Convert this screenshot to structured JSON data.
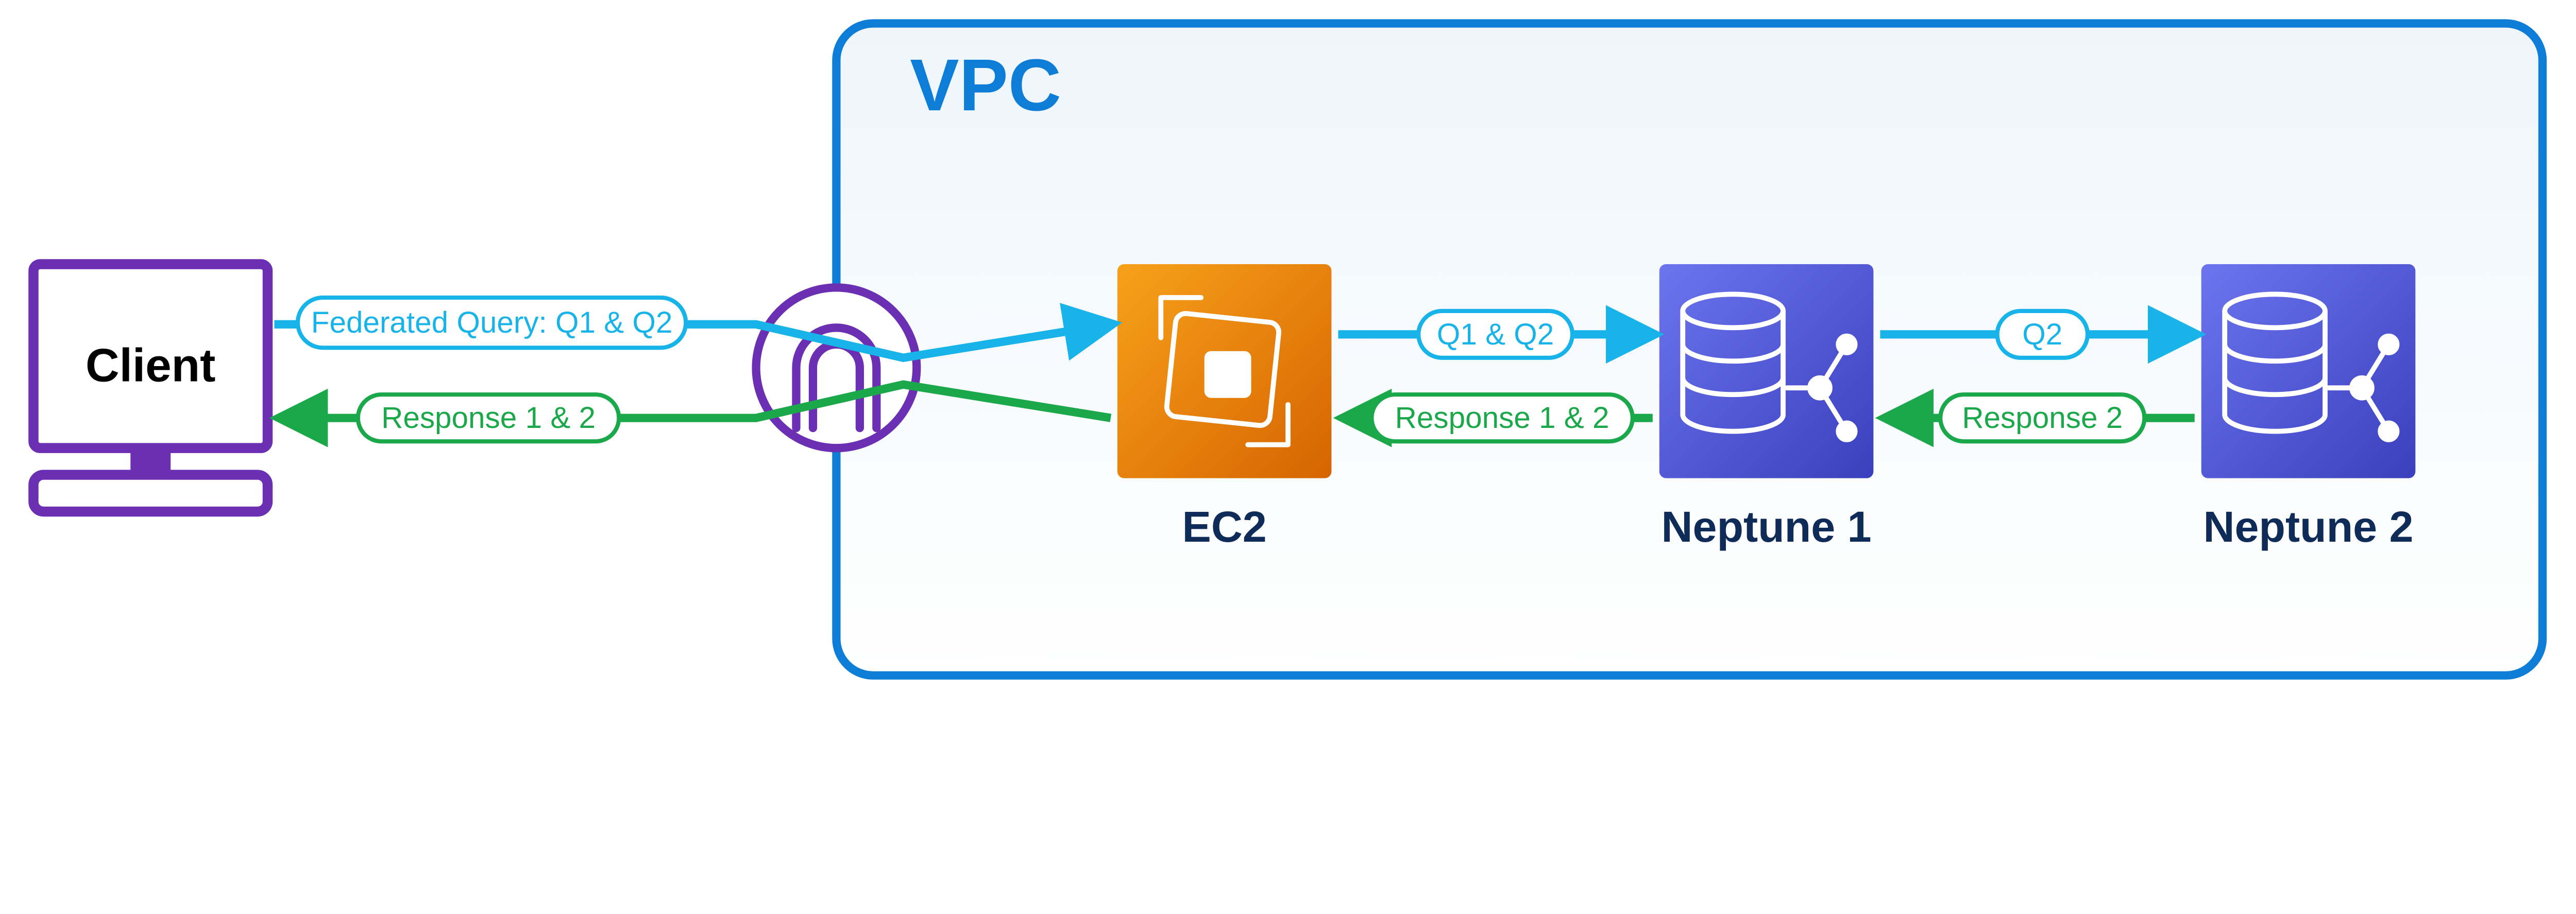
{
  "colors": {
    "purple": "#6B2FB3",
    "blue_border": "#0E7DD8",
    "cyan": "#18B4E9",
    "green": "#1BA84A",
    "navy": "#0F2C59",
    "ec2_a": "#F58B00",
    "ec2_b": "#D66400",
    "neptune_a": "#5B63E3",
    "neptune_b": "#3A3FBE"
  },
  "vpc_label": "VPC",
  "client_label": "Client",
  "ec2_label": "EC2",
  "neptune1_label": "Neptune 1",
  "neptune2_label": "Neptune 2",
  "federated_label": "Federated Query: Q1 & Q2",
  "q12_label": "Q1 & Q2",
  "q2_label": "Q2",
  "resp12_a": "Response 1 & 2",
  "resp12_b": "Response 1 & 2",
  "resp2_label": "Response 2"
}
